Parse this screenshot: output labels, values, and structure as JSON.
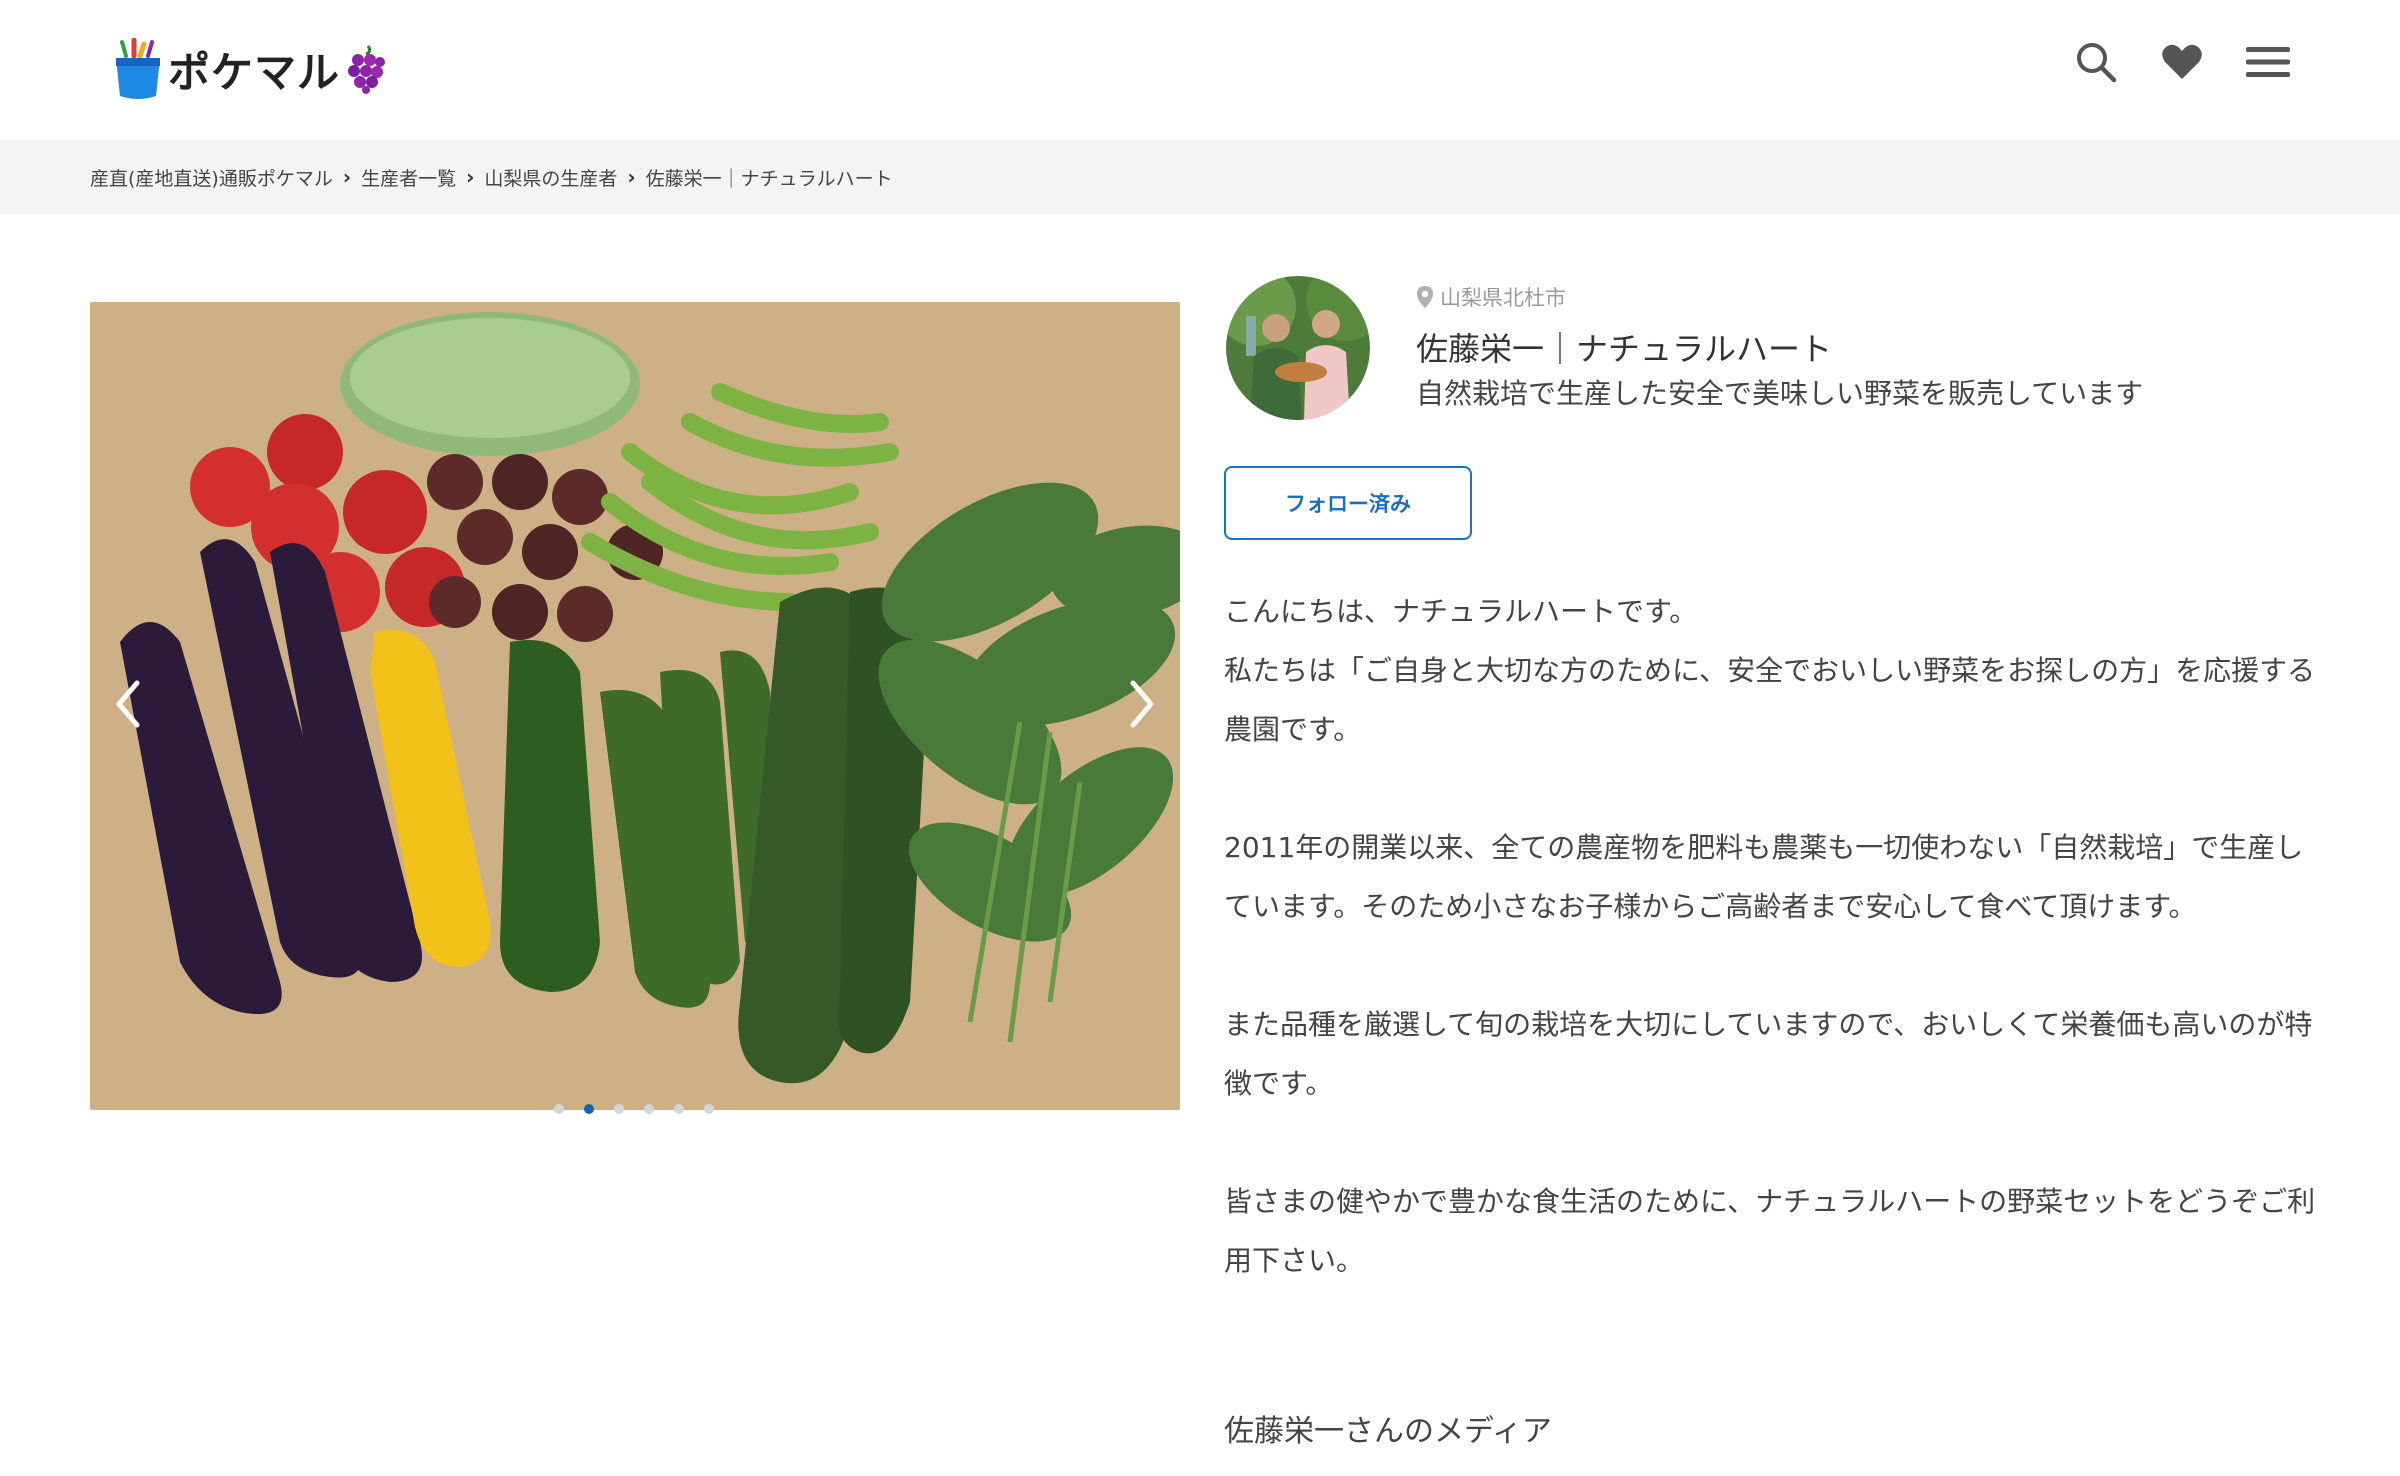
{
  "header": {
    "logo_text": "ポケマル",
    "icons": [
      "search-icon",
      "heart-icon",
      "menu-icon"
    ]
  },
  "breadcrumb": [
    "産直(産地直送)通販ポケマル",
    "生産者一覧",
    "山梨県の生産者",
    "佐藤栄一｜ナチュラルハート"
  ],
  "slider": {
    "slide_count": 6,
    "active_index": 1
  },
  "producer": {
    "location": "山梨県北杜市",
    "name": "佐藤栄一｜ナチュラルハート",
    "tagline": "自然栽培で生産した安全で美味しい野菜を販売しています",
    "follow_label": "フォロー済み"
  },
  "description": {
    "paragraphs": [
      "こんにちは、ナチュラルハートです。\n私たちは「ご自身と大切な方のために、安全でおいしい野菜をお探しの方」を応援する農園です。",
      "2011年の開業以来、全ての農産物を肥料も農薬も一切使わない「自然栽培」で生産しています。そのため小さなお子様からご高齢者まで安心して食べて頂けます。",
      "また品種を厳選して旬の栽培を大切にしていますので、おいしくて栄養価も高いのが特徴です。",
      "皆さまの健やかで豊かな食生活のために、ナチュラルハートの野菜セットをどうぞご利用下さい。"
    ],
    "media_heading": "佐藤栄一さんのメディア"
  },
  "colors": {
    "accent": "#1a73c1",
    "breadcrumb_bg": "#f4f4f4"
  }
}
